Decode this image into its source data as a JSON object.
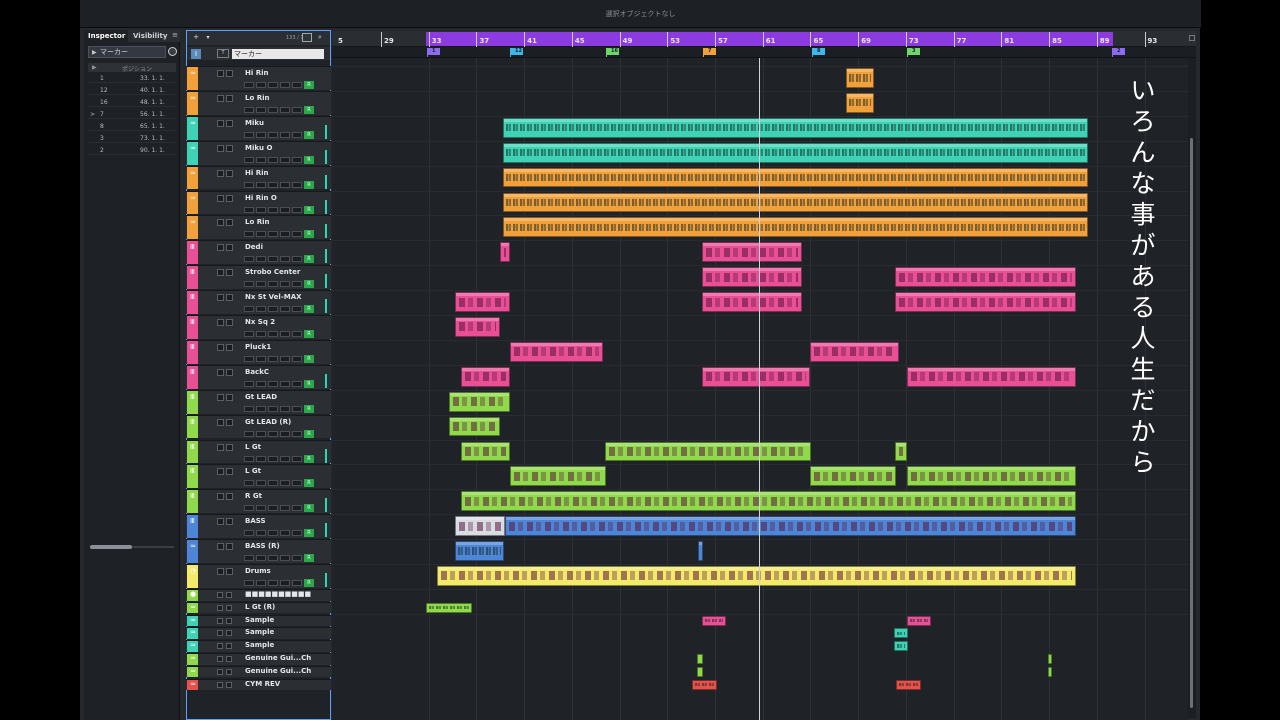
{
  "window": {
    "title": "選択オブジェクトなし"
  },
  "inspector": {
    "tab_inspector": "Inspector",
    "tab_visibility": "Visibility",
    "menu_icon": "hamburger-icon",
    "marker_track_label": "マーカー",
    "column_header": "ポジション",
    "markers": [
      {
        "id": "1",
        "pos": "33. 1. 1."
      },
      {
        "id": "12",
        "pos": "40. 1. 1."
      },
      {
        "id": "16",
        "pos": "48. 1. 1."
      },
      {
        "id": "7",
        "pos": "56. 1. 1.",
        "active": true
      },
      {
        "id": "8",
        "pos": "65. 1. 1."
      },
      {
        "id": "3",
        "pos": "73. 1. 1."
      },
      {
        "id": "2",
        "pos": "90. 1. 1."
      }
    ]
  },
  "tracklist": {
    "track_count": "133 / 133",
    "marker_track_name": "マーカー",
    "tracks": [
      {
        "name": "Hi Rin",
        "color": "#f2a13a",
        "kind": "audio"
      },
      {
        "name": "Lo Rin",
        "color": "#f2a13a",
        "kind": "audio"
      },
      {
        "name": "Miku",
        "color": "#3fd3b5",
        "kind": "audio"
      },
      {
        "name": "Miku O",
        "color": "#3fd3b5",
        "kind": "audio"
      },
      {
        "name": "Hi Rin",
        "color": "#f2a13a",
        "kind": "audio"
      },
      {
        "name": "Hi Rin O",
        "color": "#f2a13a",
        "kind": "audio"
      },
      {
        "name": "Lo Rin",
        "color": "#f2a13a",
        "kind": "audio"
      },
      {
        "name": "Dedi",
        "color": "#e84f95",
        "kind": "instrument"
      },
      {
        "name": "Strobo Center",
        "color": "#e84f95",
        "kind": "instrument"
      },
      {
        "name": "Nx St Vel-MAX",
        "color": "#e84f95",
        "kind": "instrument"
      },
      {
        "name": "Nx Sq 2",
        "color": "#e84f95",
        "kind": "instrument"
      },
      {
        "name": "Pluck1",
        "color": "#e84f95",
        "kind": "instrument"
      },
      {
        "name": "BackC",
        "color": "#e84f95",
        "kind": "instrument"
      },
      {
        "name": "Gt LEAD",
        "color": "#8fd94a",
        "kind": "instrument"
      },
      {
        "name": "Gt LEAD (R)",
        "color": "#8fd94a",
        "kind": "instrument"
      },
      {
        "name": "L Gt",
        "color": "#8fd94a",
        "kind": "instrument"
      },
      {
        "name": "L Gt",
        "color": "#8fd94a",
        "kind": "instrument"
      },
      {
        "name": "R Gt",
        "color": "#8fd94a",
        "kind": "instrument"
      },
      {
        "name": "BASS",
        "color": "#4d86d6",
        "kind": "instrument"
      },
      {
        "name": "BASS (R)",
        "color": "#4d86d6",
        "kind": "audio"
      },
      {
        "name": "Drums",
        "color": "#f3ea6a",
        "kind": "drum"
      }
    ],
    "small_tracks": [
      {
        "name": "■■■■■■■■■■",
        "color": "#8fd94a",
        "kind": "folder"
      },
      {
        "name": "L Gt (R)",
        "color": "#8fd94a",
        "kind": "audio"
      },
      {
        "name": "Sample",
        "color": "#3fd3b5",
        "kind": "audio"
      },
      {
        "name": "Sample",
        "color": "#3fd3b5",
        "kind": "audio"
      },
      {
        "name": "Sample",
        "color": "#3fd3b5",
        "kind": "audio"
      },
      {
        "name": "Genuine Gui...Ch",
        "color": "#8fd94a",
        "kind": "audio"
      },
      {
        "name": "Genuine Gui...Ch",
        "color": "#8fd94a",
        "kind": "audio"
      },
      {
        "name": "CYM REV",
        "color": "#e8504a",
        "kind": "audio"
      }
    ]
  },
  "ruler": {
    "bars": [
      "5",
      "29",
      "33",
      "37",
      "41",
      "45",
      "49",
      "53",
      "57",
      "61",
      "65",
      "69",
      "73",
      "77",
      "81",
      "85",
      "89",
      "93"
    ],
    "loop_color": "#8b3be0"
  },
  "marker_flags": [
    {
      "label": "1",
      "color": "#8b6cf0"
    },
    {
      "label": "12",
      "color": "#3fb7e8"
    },
    {
      "label": "16",
      "color": "#6fd66b"
    },
    {
      "label": "7",
      "color": "#f2a13a"
    },
    {
      "label": "8",
      "color": "#3fb7e8"
    },
    {
      "label": "3",
      "color": "#6fd66b"
    },
    {
      "label": "2",
      "color": "#8b6cf0"
    }
  ],
  "lyrics": [
    "い",
    "ろ",
    "ん",
    "な",
    " ",
    "事",
    "が",
    "あ",
    "る",
    " ",
    "人",
    "生",
    "だ",
    "か",
    "ら"
  ]
}
